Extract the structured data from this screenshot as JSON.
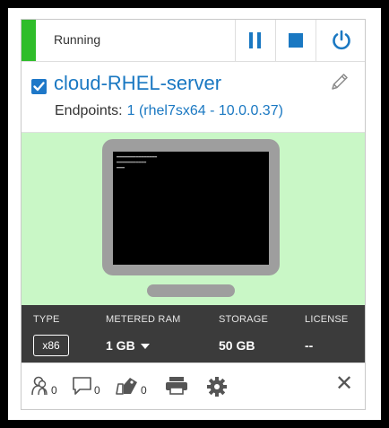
{
  "status": {
    "text": "Running",
    "color": "#2fbd2a"
  },
  "controls": {
    "pause": "pause-icon",
    "stop": "stop-icon",
    "power": "power-icon",
    "accent": "#1a78c2"
  },
  "vm": {
    "name": "cloud-RHEL-server",
    "selected": true,
    "endpoints_label": "Endpoints:",
    "endpoints_value": "1 (rhel7sx64 - 10.0.0.37)"
  },
  "specs": {
    "type_label": "TYPE",
    "type_value": "x86",
    "ram_label": "METERED RAM",
    "ram_value": "1 GB",
    "storage_label": "STORAGE",
    "storage_value": "50 GB",
    "license_label": "LICENSE",
    "license_value": "--"
  },
  "actions": {
    "users_count": "0",
    "comments_count": "0",
    "tags_count": "0"
  }
}
